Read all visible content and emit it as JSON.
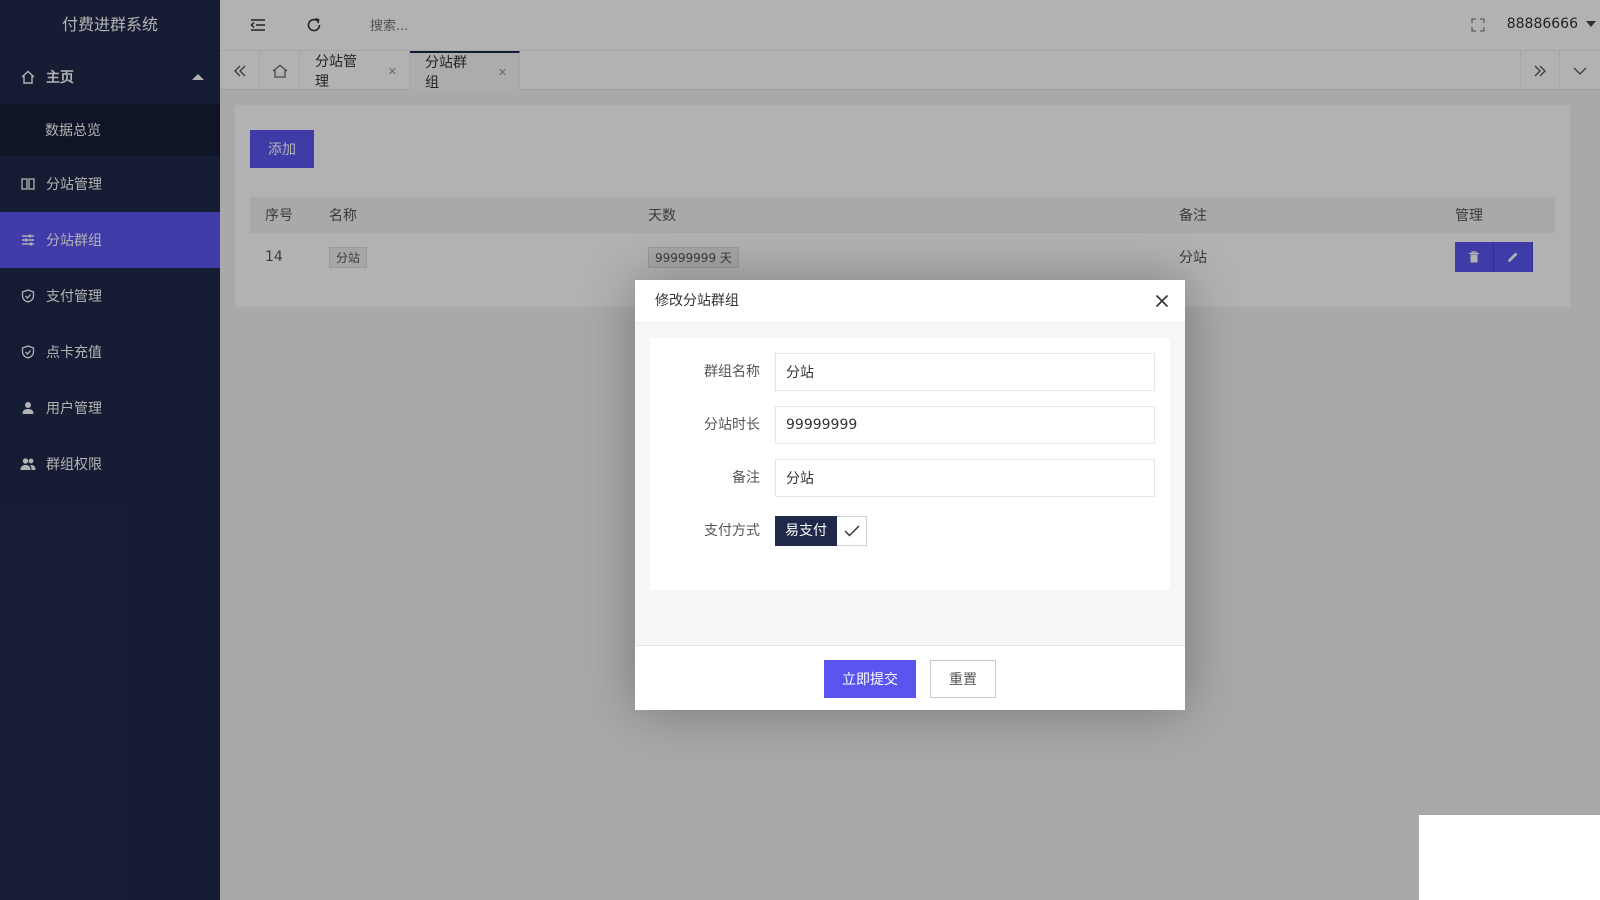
{
  "sidebar": {
    "brand": "付费进群系统",
    "home": "主页",
    "home_sub": "数据总览",
    "items": [
      {
        "label": "分站管理",
        "icon": "book-icon"
      },
      {
        "label": "分站群组",
        "icon": "sliders-icon"
      },
      {
        "label": "支付管理",
        "icon": "shield-check-icon"
      },
      {
        "label": "点卡充值",
        "icon": "shield-check-icon"
      },
      {
        "label": "用户管理",
        "icon": "user-icon"
      },
      {
        "label": "群组权限",
        "icon": "users-icon"
      }
    ],
    "active": "分站群组",
    "bg_color": "#20294a",
    "active_color": "#5b55f0"
  },
  "header": {
    "search_placeholder": "搜索...",
    "username": "88886666"
  },
  "tabs": [
    {
      "label": "分站管理",
      "active": false
    },
    {
      "label": "分站群组",
      "active": true
    }
  ],
  "main": {
    "add_button": "添加",
    "table": {
      "columns": [
        "序号",
        "名称",
        "天数",
        "备注",
        "管理"
      ],
      "rows": [
        {
          "id": "14",
          "name": "分站",
          "days": "99999999 天",
          "note": "分站"
        }
      ]
    }
  },
  "modal": {
    "title": "修改分站群组",
    "fields": {
      "group_name_label": "群组名称",
      "group_name_value": "分站",
      "duration_label": "分站时长",
      "duration_value": "99999999",
      "note_label": "备注",
      "note_value": "分站",
      "payment_label": "支付方式",
      "payment_option": "易支付",
      "payment_checked": true
    },
    "submit": "立即提交",
    "reset": "重置"
  }
}
